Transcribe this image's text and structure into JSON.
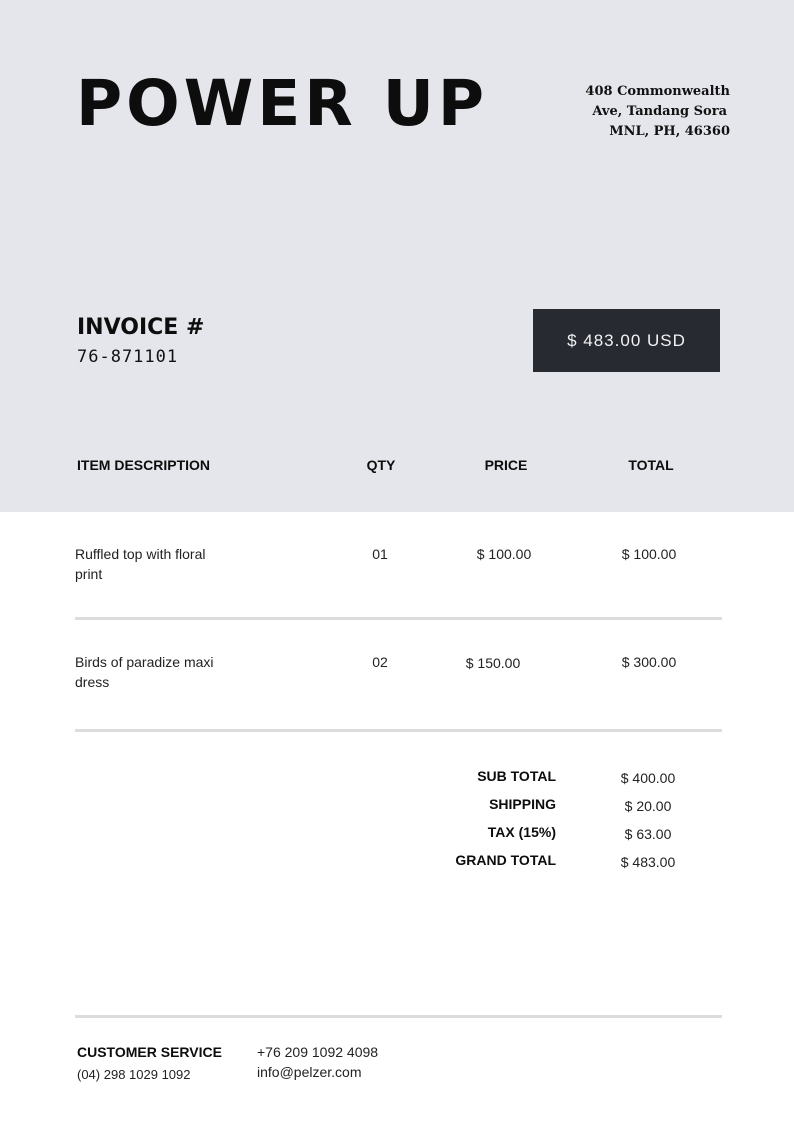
{
  "brand": "POWER UP",
  "address": [
    "408 Commonwealth",
    "Ave, Tandang Sora",
    "MNL, PH, 46360"
  ],
  "invoice": {
    "label": "INVOICE #",
    "number": "76-871101",
    "amount": "$ 483.00 USD"
  },
  "table": {
    "headers": [
      "ITEM DESCRIPTION",
      "QTY",
      "PRICE",
      "TOTAL"
    ],
    "rows": [
      {
        "desc_line1": "Ruffled top with floral",
        "desc_line2": "print",
        "qty": "01",
        "price": "$ 100.00",
        "total": "$ 100.00"
      },
      {
        "desc_line1": "Birds of paradize maxi",
        "desc_line2": "dress",
        "qty": "02",
        "price": "$ 150.00",
        "total": "$ 300.00"
      }
    ]
  },
  "summary": [
    {
      "label": "SUB TOTAL",
      "value": "$ 400.00"
    },
    {
      "label": "SHIPPING",
      "value": "$ 20.00"
    },
    {
      "label": "TAX (15%)",
      "value": "$ 63.00"
    },
    {
      "label": "GRAND TOTAL",
      "value": "$ 483.00"
    }
  ],
  "footer": {
    "title": "CUSTOMER SERVICE",
    "phone1": "(04) 298 1029 1092",
    "phone2": "+76 209 1092 4098",
    "email": "info@pelzer.com"
  },
  "colors": {
    "band": "#e5e6ec",
    "amount_box": "#272a31",
    "rule": "#dcdcdc"
  }
}
